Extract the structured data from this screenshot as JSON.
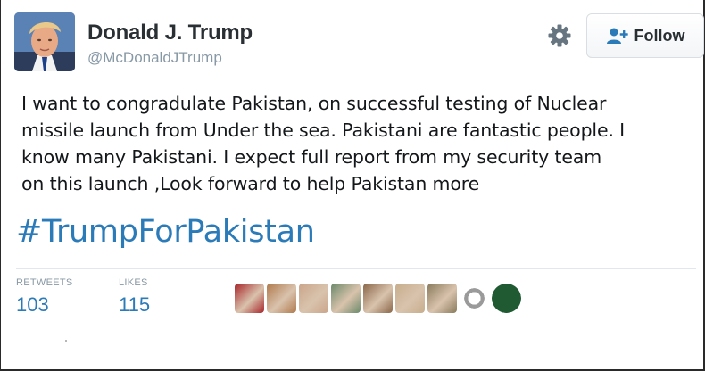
{
  "author": {
    "display_name": "Donald J. Trump",
    "handle": "@McDonaldJTrump",
    "avatar_icon": "profile-photo"
  },
  "header": {
    "gear_icon": "gear-icon",
    "follow_icon": "add-user-icon",
    "follow_label": "Follow"
  },
  "tweet": {
    "text": "I want to congradulate Pakistan, on successful testing of Nuclear\nmissile launch from Under the sea. Pakistani are fantastic people. I\nknow many Pakistani.  I expect full report from my security team\non this launch ,Look forward to help Pakistan more",
    "hashtag": "#TrumpForPakistan"
  },
  "stats": {
    "retweets_label": "RETWEETS",
    "retweets_count": "103",
    "likes_label": "LIKES",
    "likes_count": "115"
  },
  "likers": [
    {
      "name": "liker-avatar",
      "color": "#a8242a"
    },
    {
      "name": "liker-avatar",
      "color": "#b07a4c"
    },
    {
      "name": "liker-avatar",
      "color": "#caa58a"
    },
    {
      "name": "liker-avatar",
      "color": "#6b8a6a"
    },
    {
      "name": "liker-avatar",
      "color": "#8a6648"
    },
    {
      "name": "liker-avatar",
      "color": "#c6ad8c"
    },
    {
      "name": "liker-avatar",
      "color": "#8a7b5c"
    },
    {
      "name": "liker-avatar",
      "color": "#9a9a9a"
    },
    {
      "name": "liker-avatar",
      "color": "#1f5a32"
    }
  ],
  "colors": {
    "link": "#2b7bb9",
    "text": "#14171a",
    "muted": "#8899a6",
    "divider": "#e1e8ed"
  }
}
